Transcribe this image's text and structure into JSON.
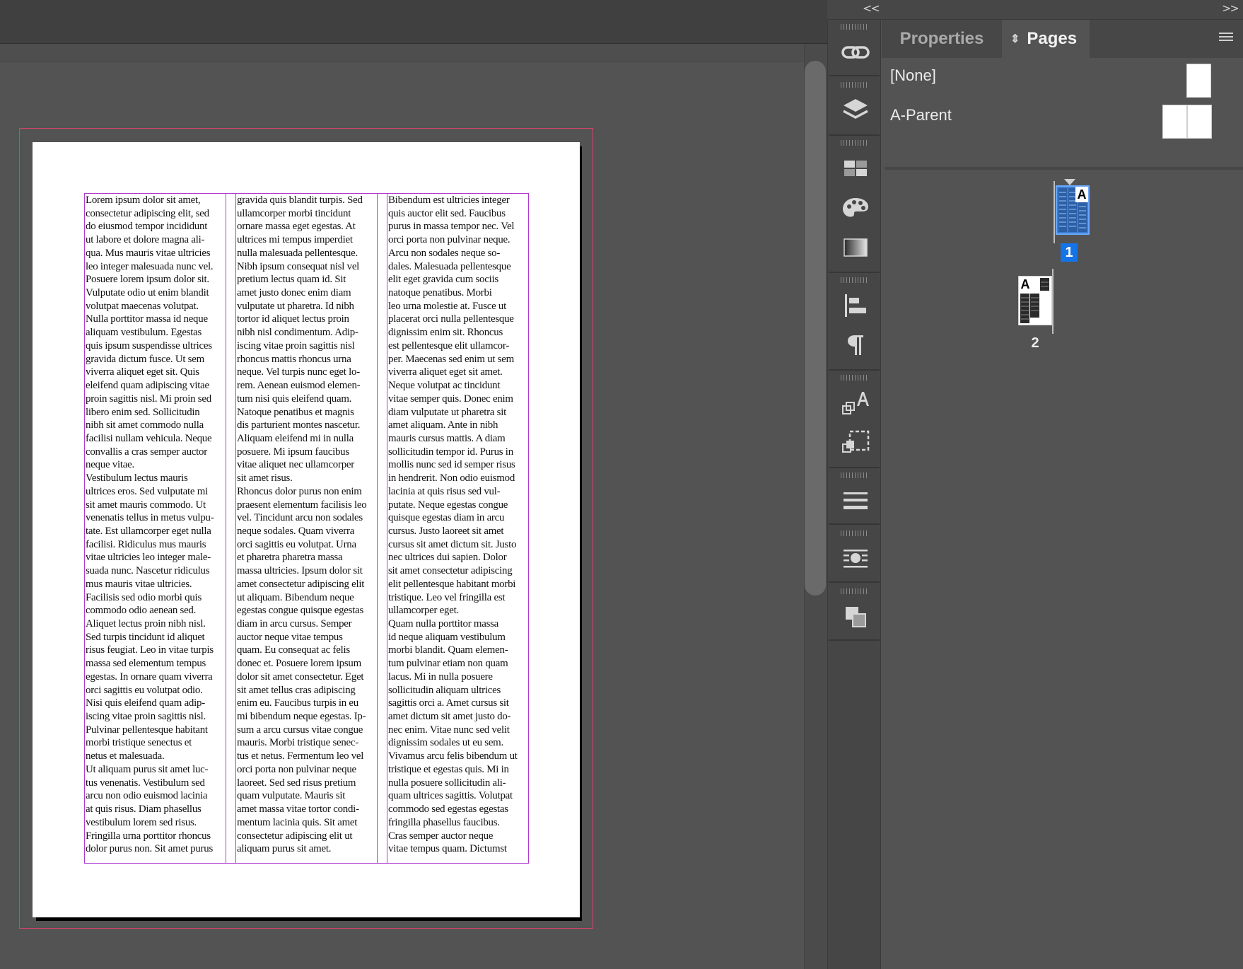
{
  "dock": {
    "collapse_left": "<<",
    "collapse_right": ">>"
  },
  "tabs": {
    "properties": "Properties",
    "pages": "Pages"
  },
  "parents": {
    "none": "[None]",
    "a_parent": "A-Parent"
  },
  "pages": [
    {
      "number": "1",
      "parent_prefix": "A",
      "selected": true
    },
    {
      "number": "2",
      "parent_prefix": "A",
      "selected": false
    }
  ],
  "document": {
    "columns": [
      "Lorem ipsum dolor sit amet,\nconsectetur adipiscing elit, sed\ndo eiusmod tempor incididunt\nut labore et dolore magna ali-\nqua. Mus mauris vitae ultricies\nleo integer malesuada nunc vel.\nPosuere lorem ipsum dolor sit.\nVulputate odio ut enim blandit\nvolutpat maecenas volutpat.\nNulla porttitor massa id neque\naliquam vestibulum. Egestas\nquis ipsum suspendisse ultrices\ngravida dictum fusce. Ut sem\nviverra aliquet eget sit. Quis\neleifend quam adipiscing vitae\nproin sagittis nisl. Mi proin sed\nlibero enim sed. Sollicitudin\nnibh sit amet commodo nulla\nfacilisi nullam vehicula. Neque\nconvallis a cras semper auctor\nneque vitae.\nVestibulum lectus mauris\nultrices eros. Sed vulputate mi\nsit amet mauris commodo. Ut\nvenenatis tellus in metus vulpu-\ntate. Est ullamcorper eget nulla\nfacilisi. Ridiculus mus mauris\nvitae ultricies leo integer male-\nsuada nunc. Nascetur ridiculus\nmus mauris vitae ultricies.\nFacilisis sed odio morbi quis\ncommodo odio aenean sed.\nAliquet lectus proin nibh nisl.\nSed turpis tincidunt id aliquet\nrisus feugiat. Leo in vitae turpis\nmassa sed elementum tempus\negestas. In ornare quam viverra\norci sagittis eu volutpat odio.\nNisi quis eleifend quam adip-\niscing vitae proin sagittis nisl.\nPulvinar pellentesque habitant\nmorbi tristique senectus et\nnetus et malesuada.\nUt aliquam purus sit amet luc-\ntus venenatis. Vestibulum sed\narcu non odio euismod lacinia\nat quis risus. Diam phasellus\nvestibulum lorem sed risus.\nFringilla urna porttitor rhoncus\ndolor purus non. Sit amet purus",
      "gravida quis blandit turpis. Sed\nullamcorper morbi tincidunt\nornare massa eget egestas. At\nultrices mi tempus imperdiet\nnulla malesuada pellentesque.\nNibh ipsum consequat nisl vel\npretium lectus quam id. Sit\namet justo donec enim diam\nvulputate ut pharetra. Id nibh\ntortor id aliquet lectus proin\nnibh nisl condimentum. Adip-\niscing vitae proin sagittis nisl\nrhoncus mattis rhoncus urna\nneque. Vel turpis nunc eget lo-\nrem. Aenean euismod elemen-\ntum nisi quis eleifend quam.\nNatoque penatibus et magnis\ndis parturient montes nascetur.\nAliquam eleifend mi in nulla\nposuere. Mi ipsum faucibus\nvitae aliquet nec ullamcorper\nsit amet risus.\nRhoncus dolor purus non enim\npraesent elementum facilisis leo\nvel. Tincidunt arcu non sodales\nneque sodales. Quam viverra\norci sagittis eu volutpat. Urna\net pharetra pharetra massa\nmassa ultricies. Ipsum dolor sit\namet consectetur adipiscing elit\nut aliquam. Bibendum neque\negestas congue quisque egestas\ndiam in arcu cursus. Semper\nauctor neque vitae tempus\nquam. Eu consequat ac felis\ndonec et. Posuere lorem ipsum\ndolor sit amet consectetur. Eget\nsit amet tellus cras adipiscing\nenim eu. Faucibus turpis in eu\nmi bibendum neque egestas. Ip-\nsum a arcu cursus vitae congue\nmauris. Morbi tristique senec-\ntus et netus. Fermentum leo vel\norci porta non pulvinar neque\nlaoreet. Sed sed risus pretium\nquam vulputate. Mauris sit\namet massa vitae tortor condi-\nmentum lacinia quis. Sit amet\nconsectetur adipiscing elit ut\naliquam purus sit amet.",
      "Bibendum est ultricies integer\nquis auctor elit sed. Faucibus\npurus in massa tempor nec. Vel\norci porta non pulvinar neque.\nArcu non sodales neque so-\ndales. Malesuada pellentesque\nelit eget gravida cum sociis\nnatoque penatibus. Morbi\nleo urna molestie at. Fusce ut\nplacerat orci nulla pellentesque\ndignissim enim sit. Rhoncus\nest pellentesque elit ullamcor-\nper. Maecenas sed enim ut sem\nviverra aliquet eget sit amet.\nNeque volutpat ac tincidunt\nvitae semper quis. Donec enim\ndiam vulputate ut pharetra sit\namet aliquam. Ante in nibh\nmauris cursus mattis. A diam\nsollicitudin tempor id. Purus in\nmollis nunc sed id semper risus\nin hendrerit. Non odio euismod\nlacinia at quis risus sed vul-\nputate. Neque egestas congue\nquisque egestas diam in arcu\ncursus. Justo laoreet sit amet\ncursus sit amet dictum sit. Justo\nnec ultrices dui sapien. Dolor\nsit amet consectetur adipiscing\nelit pellentesque habitant morbi\ntristique. Leo vel fringilla est\nullamcorper eget.\nQuam nulla porttitor massa\nid neque aliquam vestibulum\nmorbi blandit. Quam elemen-\ntum pulvinar etiam non quam\nlacus. Mi in nulla posuere\nsollicitudin aliquam ultrices\nsagittis orci a. Amet cursus sit\namet dictum sit amet justo do-\nnec enim. Vitae nunc sed velit\ndignissim sodales ut eu sem.\nVivamus arcu felis bibendum ut\ntristique et egestas quis. Mi in\nnulla posuere sollicitudin ali-\nquam ultrices sagittis. Volutpat\ncommodo sed egestas egestas\nfringilla phasellus faucibus.\nCras semper auctor neque\nvitae tempus quam. Dictumst"
    ]
  },
  "colors": {
    "accent_selected": "#1473e6",
    "frame_edge": "#b03bd0",
    "bleed_guide": "#d6436b"
  }
}
